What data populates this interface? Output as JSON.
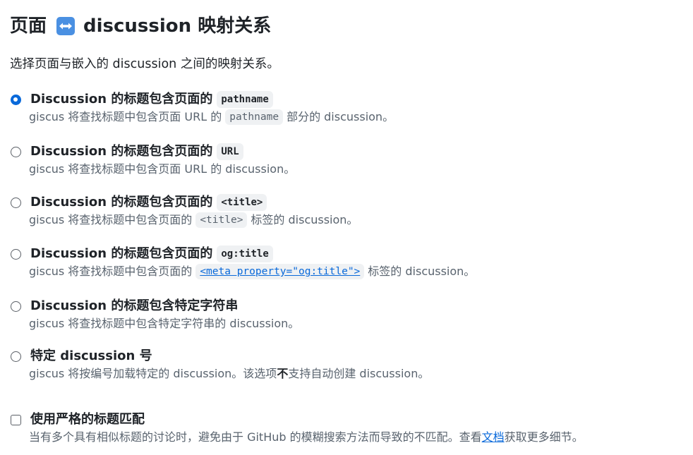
{
  "header": {
    "title_left": "页面",
    "title_right": "discussion 映射关系",
    "icon": "left-right-arrow-icon",
    "icon_color": "#4a90e2"
  },
  "intro": "选择页面与嵌入的 discussion 之间的映射关系。",
  "colors": {
    "accent": "#0969da",
    "text": "#1f2328",
    "muted": "#59636e",
    "code_bg": "#eff1f3"
  },
  "options": [
    {
      "label": "Discussion 的标题包含页面的",
      "code": "pathname",
      "desc_before": "giscus 将查找标题中包含页面 URL 的",
      "desc_code": "pathname",
      "desc_after": "部分的 discussion。",
      "checked": true
    },
    {
      "label": "Discussion 的标题包含页面的",
      "code": "URL",
      "desc": "giscus 将查找标题中包含页面 URL 的 discussion。",
      "checked": false
    },
    {
      "label": "Discussion 的标题包含页面的",
      "code": "<title>",
      "desc_before": "giscus 将查找标题中包含页面的",
      "desc_code": "<title>",
      "desc_after": "标签的 discussion。",
      "checked": false
    },
    {
      "label": "Discussion 的标题包含页面的",
      "code": "og:title",
      "desc_before": "giscus 将查找标题中包含页面的",
      "desc_code": "<meta property=\"og:title\">",
      "desc_after": "标签的 discussion。",
      "checked": false
    },
    {
      "label": "Discussion 的标题包含特定字符串",
      "desc": "giscus 将查找标题中包含特定字符串的 discussion。",
      "checked": false
    },
    {
      "label": "特定 discussion 号",
      "desc_before": "giscus 将按编号加载特定的 discussion。该选项",
      "desc_strong": "不",
      "desc_after": "支持自动创建 discussion。",
      "checked": false
    }
  ],
  "strict": {
    "label": "使用严格的标题匹配",
    "desc_before": "当有多个具有相似标题的讨论时，避免由于 GitHub 的模糊搜索方法而导致的不匹配。查看",
    "link": "文档",
    "desc_after": "获取更多细节。",
    "checked": false
  }
}
